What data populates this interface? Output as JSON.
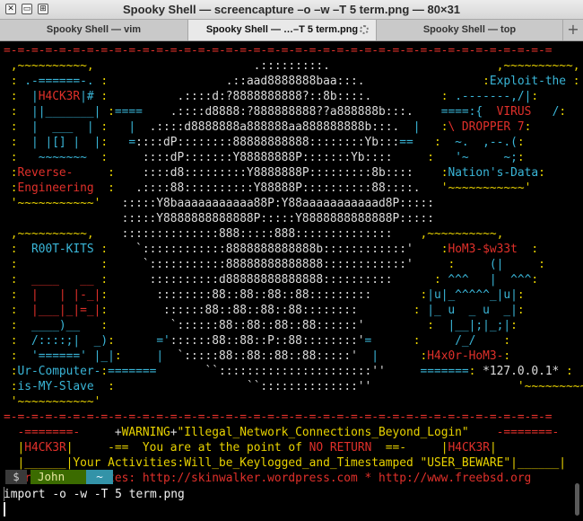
{
  "window": {
    "title": "Spooky Shell — screencapture –o –w –T 5 term.png — 80×31",
    "controls": [
      {
        "name": "close-icon",
        "glyph": "✕"
      },
      {
        "name": "minimize-icon",
        "glyph": "▭"
      },
      {
        "name": "zoom-icon",
        "glyph": "⊞"
      }
    ]
  },
  "tabs": [
    {
      "label": "Spooky Shell — vim",
      "active": false
    },
    {
      "label": "Spooky Shell — …–T 5 term.png",
      "active": true
    },
    {
      "label": "Spooky Shell — top",
      "active": false
    }
  ],
  "new_tab_label": "+",
  "colors": {
    "red": "#e0302a",
    "yellow": "#e8d200",
    "cyan": "#3ab6d8",
    "white": "#dcdcdc",
    "gray": "#bdbdbd",
    "green": "#7fb800",
    "orange": "#e89c20",
    "magenta": "#e0302a"
  },
  "ascii_lines": [
    [
      [
        "r",
        "=-=-=-=-=-=-=-=-=-=-=-=-=-=-=-=-=-=-=-=-=-=-=-=-=-=-=-=-=-=-=-=-=-=-=-=-=-=-=-="
      ]
    ],
    [
      [
        "y",
        " ,~~~~~~~~~~,                       "
      ],
      [
        "w",
        ".:::::::::.                        "
      ],
      [
        "y",
        ",~~~~~~~~~~,"
      ]
    ],
    [
      [
        "y",
        " :"
      ],
      [
        "c",
        " .-======-."
      ],
      [
        "y",
        " :                 "
      ],
      [
        "w",
        ".::aad8888888baa:::.                 "
      ],
      [
        "y",
        ":"
      ],
      [
        "c",
        "Exploit-the"
      ],
      [
        "y",
        " :"
      ]
    ],
    [
      [
        "y",
        " :"
      ],
      [
        "c",
        "  |"
      ],
      [
        "r",
        "H4CK3R"
      ],
      [
        "c",
        "|#"
      ],
      [
        "y",
        " :          "
      ],
      [
        "w",
        ".::::d:?8888888888?::8b::::.          "
      ],
      [
        "y",
        ":"
      ],
      [
        "c",
        " .-------,/|"
      ],
      [
        "y",
        ":"
      ]
    ],
    [
      [
        "y",
        " :"
      ],
      [
        "c",
        "  ||_______|"
      ],
      [
        "y",
        " :"
      ],
      [
        "c",
        "====    "
      ],
      [
        "w",
        ".::::d8888:?888888888??a888888b:::.    "
      ],
      [
        "c",
        "====:{"
      ],
      [
        "r",
        "  VIRUS   "
      ],
      [
        "c",
        "/"
      ],
      [
        "y",
        ":"
      ]
    ],
    [
      [
        "y",
        " :"
      ],
      [
        "c",
        "  |  ___  |"
      ],
      [
        "y",
        " :"
      ],
      [
        "c",
        "   |  "
      ],
      [
        "w",
        ".::::d8888888a888888aa888888888b:::.  "
      ],
      [
        "c",
        "|   "
      ],
      [
        "y",
        ":"
      ],
      [
        "r",
        "\\ DROPPER 7"
      ],
      [
        "y",
        ":"
      ]
    ],
    [
      [
        "y",
        " :"
      ],
      [
        "c",
        "  | |[] |  |"
      ],
      [
        "y",
        ":"
      ],
      [
        "c",
        "   ="
      ],
      [
        "w",
        "::::dP::::::::88888888888::::::::Yb:::"
      ],
      [
        "c",
        "=="
      ],
      [
        "y",
        "   :"
      ],
      [
        "c",
        "  ~.  ,--.("
      ],
      [
        "y",
        ":"
      ]
    ],
    [
      [
        "y",
        " :"
      ],
      [
        "c",
        "   ~~~~~~~"
      ],
      [
        "y",
        "  :     "
      ],
      [
        "w",
        "::::dP:::::::Y88888888P:::::::Yb::::     "
      ],
      [
        "y",
        ":"
      ],
      [
        "c",
        "   '~     ~;"
      ],
      [
        "y",
        ":"
      ]
    ],
    [
      [
        "y",
        " :"
      ],
      [
        "r",
        "Reverse-"
      ],
      [
        "y",
        "     :    "
      ],
      [
        "w",
        "::::d8:::::::::Y8888888P:::::::::8b::::    "
      ],
      [
        "y",
        ":"
      ],
      [
        "c",
        "Nation's-Data"
      ],
      [
        "y",
        ":"
      ]
    ],
    [
      [
        "y",
        " :"
      ],
      [
        "r",
        "Engineering"
      ],
      [
        "y",
        "  :   "
      ],
      [
        "w",
        ".::::88::::::::::Y88888P::::::::::88::::.   "
      ],
      [
        "y",
        "'~~~~~~~~~~~'"
      ]
    ],
    [
      [
        "y",
        " '~~~~~~~~~~~'   "
      ],
      [
        "w",
        ":::::Y8baaaaaaaaaaa88P:Y88aaaaaaaaaaad8P:::::"
      ]
    ],
    [
      [
        "w",
        "                 :::::Y8888888888888P:::::Y8888888888888P:::::"
      ]
    ],
    [
      [
        "y",
        " ,~~~~~~~~~~,    "
      ],
      [
        "w",
        "::::::::::::::888:::::888::::::::::::::    "
      ],
      [
        "y",
        ",~~~~~~~~~~,"
      ]
    ],
    [
      [
        "y",
        " :"
      ],
      [
        "c",
        "  R00T-KITS"
      ],
      [
        "y",
        " :    "
      ],
      [
        "w",
        "`::::::::::::8888888888888b::::::::::::'    "
      ],
      [
        "y",
        ":"
      ],
      [
        "r",
        "HoM3-$w33t"
      ],
      [
        "y",
        "  :"
      ]
    ],
    [
      [
        "y",
        " :"
      ],
      [
        "c",
        "            "
      ],
      [
        "y",
        ":     "
      ],
      [
        "w",
        "`:::::::::::88888888888888::::::::::::'     "
      ],
      [
        "y",
        ":"
      ],
      [
        "c",
        "     (|     "
      ],
      [
        "y",
        ":"
      ]
    ],
    [
      [
        "y",
        " :"
      ],
      [
        "r",
        "  ____   __ "
      ],
      [
        "y",
        ":      "
      ],
      [
        "w",
        "::::::::::d88888888888888::::::::::      "
      ],
      [
        "y",
        ":"
      ],
      [
        "c",
        " ^^^   |  ^^^"
      ],
      [
        "y",
        ":"
      ]
    ],
    [
      [
        "y",
        " :"
      ],
      [
        "r",
        "  |   | |-_|"
      ],
      [
        "y",
        ":       "
      ],
      [
        "w",
        "::::::::88::88::88::88:::::::::       "
      ],
      [
        "y",
        ":"
      ],
      [
        "c",
        "|u|_^^^^^_|u|"
      ],
      [
        "y",
        ":"
      ]
    ],
    [
      [
        "y",
        " :"
      ],
      [
        "r",
        "  |___|_|=_|"
      ],
      [
        "y",
        ":        "
      ],
      [
        "w",
        "::::::88::88::88::88::::::::        "
      ],
      [
        "y",
        ":"
      ],
      [
        "c",
        " |_ u  _ u  _|"
      ],
      [
        "y",
        ":"
      ]
    ],
    [
      [
        "y",
        " :"
      ],
      [
        "c",
        "  ____)__"
      ],
      [
        "y",
        "   :         "
      ],
      [
        "w",
        "`::::::88::88::88::88::::::'         "
      ],
      [
        "y",
        ":"
      ],
      [
        "c",
        "  |__|;|_;|"
      ],
      [
        "y",
        ":"
      ]
    ],
    [
      [
        "y",
        " :"
      ],
      [
        "c",
        "  /::::;|  _)"
      ],
      [
        "y",
        ":      "
      ],
      [
        "c",
        "='"
      ],
      [
        "w",
        "::::::88::88::P::88::::::::'"
      ],
      [
        "c",
        "=      "
      ],
      [
        "y",
        ":"
      ],
      [
        "c",
        "     /_/    "
      ],
      [
        "y",
        ":"
      ]
    ],
    [
      [
        "y",
        " :"
      ],
      [
        "c",
        "  '======' |_|"
      ],
      [
        "y",
        ":     "
      ],
      [
        "c",
        "|  "
      ],
      [
        "w",
        "`:::::88::88::88::88:::::'"
      ],
      [
        "c",
        "  |      "
      ],
      [
        "y",
        ":"
      ],
      [
        "r",
        "H4x0r-HoM3-"
      ],
      [
        "y",
        ":"
      ]
    ],
    [
      [
        "y",
        " :"
      ],
      [
        "c",
        "Ur-Computer-"
      ],
      [
        "y",
        ":"
      ],
      [
        "c",
        "=======       "
      ],
      [
        "w",
        "``::::::::::::::::::::::''"
      ],
      [
        "c",
        "     ======="
      ],
      [
        "y",
        ":"
      ],
      [
        "w",
        " *127.0.0.1*"
      ],
      [
        "y",
        " :"
      ]
    ],
    [
      [
        "y",
        " :"
      ],
      [
        "c",
        "is-MY-Slave"
      ],
      [
        "y",
        "  :                   "
      ],
      [
        "w",
        "``::::::::::::::''"
      ],
      [
        "y",
        "                     '~~~~~~~~~~~'"
      ]
    ],
    [
      [
        "y",
        " '~~~~~~~~~~~'"
      ]
    ],
    [
      [
        "r",
        "=-=-=-=-=-=-=-=-=-=-=-=-=-=-=-=-=-=-=-=-=-=-=-=-=-=-=-=-=-=-=-=-=-=-=-=-=-=-=-="
      ]
    ],
    [
      [
        "r",
        "  -=======-"
      ],
      [
        "w",
        "     +"
      ],
      [
        "y",
        "WARNING"
      ],
      [
        "w",
        "+"
      ],
      [
        "y",
        "\"Illegal_Network_Connections_Beyond_Login\""
      ],
      [
        "r",
        "    -=======-"
      ]
    ],
    [
      [
        "y",
        "  |"
      ],
      [
        "r",
        "H4CK3R"
      ],
      [
        "y",
        "|"
      ],
      [
        "y",
        "     -==  You are at the point of "
      ],
      [
        "r",
        "NO RETURN"
      ],
      [
        "y",
        "  ==-     "
      ],
      [
        "y",
        "|"
      ],
      [
        "r",
        "H4CK3R"
      ],
      [
        "y",
        "|"
      ]
    ],
    [
      [
        "y",
        "  |______|"
      ],
      [
        "y",
        "Your Activities:Will_be_Keylogged_and_Timestamped \"USER_BEWARE\""
      ],
      [
        "y",
        "|______|"
      ]
    ],
    [
      [
        "r",
        "  Private Websites: http://skinwalker.wordpress.com * http://www.freebsd.org"
      ]
    ]
  ],
  "prompt": {
    "symbol": "$",
    "user": "John",
    "dir": "~"
  },
  "command": "import -o -w -T 5 term.png"
}
